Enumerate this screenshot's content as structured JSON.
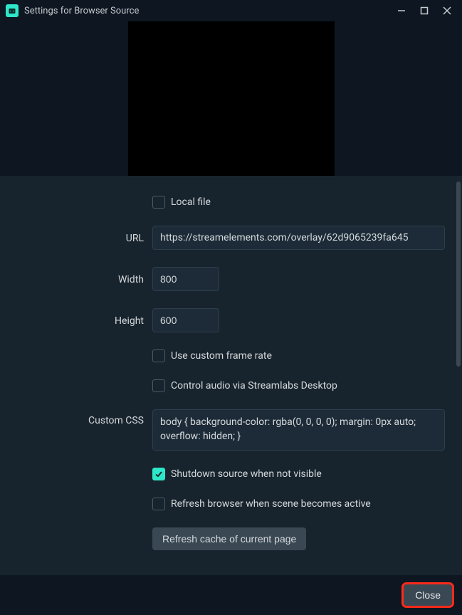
{
  "window": {
    "title": "Settings for Browser Source"
  },
  "form": {
    "local_file_label": "Local file",
    "local_file_checked": false,
    "url_label": "URL",
    "url_value": "https://streamelements.com/overlay/62d9065239fa645",
    "width_label": "Width",
    "width_value": "800",
    "height_label": "Height",
    "height_value": "600",
    "custom_frame_label": "Use custom frame rate",
    "custom_frame_checked": false,
    "control_audio_label": "Control audio via Streamlabs Desktop",
    "control_audio_checked": false,
    "custom_css_label": "Custom CSS",
    "custom_css_value": "body { background-color: rgba(0, 0, 0, 0); margin: 0px auto; overflow: hidden; }",
    "shutdown_label": "Shutdown source when not visible",
    "shutdown_checked": true,
    "refresh_active_label": "Refresh browser when scene becomes active",
    "refresh_active_checked": false,
    "refresh_cache_button": "Refresh cache of current page"
  },
  "footer": {
    "close_label": "Close"
  }
}
